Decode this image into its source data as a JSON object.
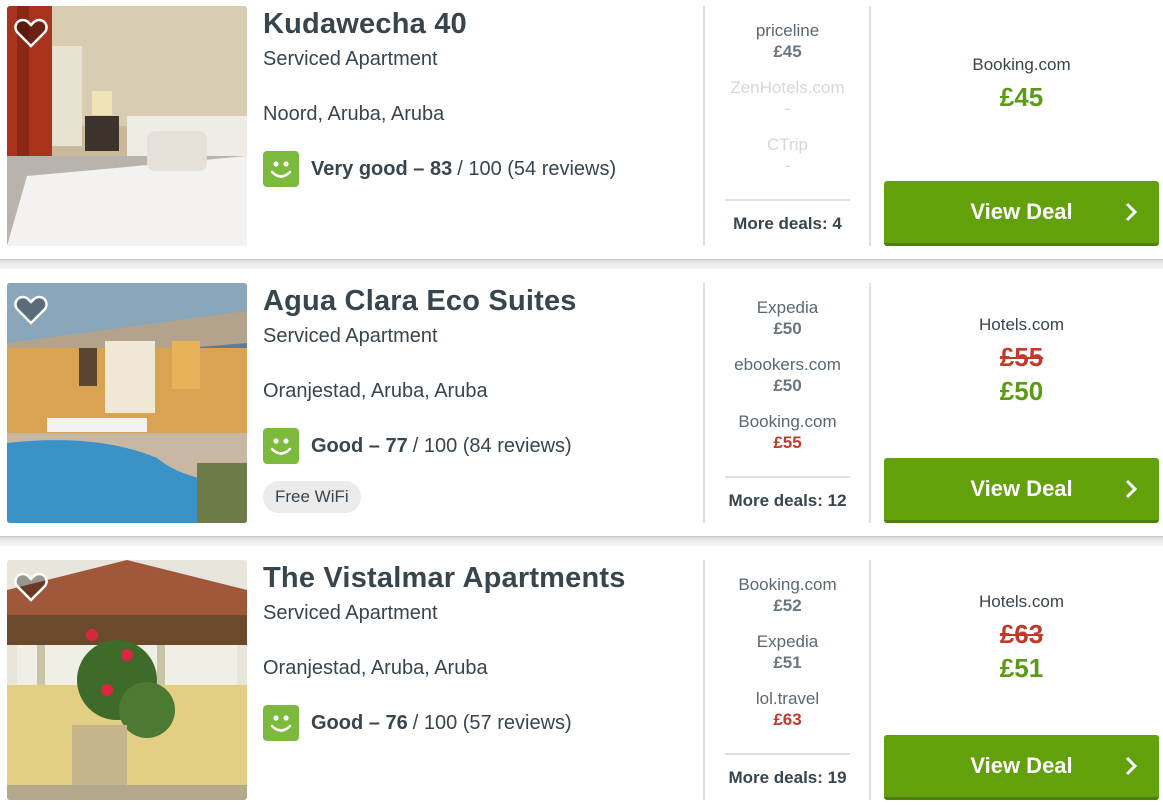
{
  "colors": {
    "accent_green": "#62a10b",
    "price_green": "#5a9a14",
    "strike_red": "#c0392b",
    "rating_green": "#7cba3d"
  },
  "icons": {
    "favorite": "heart-icon",
    "rating": "smiley-icon",
    "chevron": "chevron-right-icon"
  },
  "hotels": [
    {
      "name": "Kudawecha 40",
      "type": "Serviced Apartment",
      "location": "Noord, Aruba, Aruba",
      "rating_word": "Very good",
      "rating_score": "83",
      "rating_rest": "/ 100 (54 reviews)",
      "providers": [
        {
          "name": "priceline",
          "price": "£45"
        },
        {
          "name": "ZenHotels.com",
          "price": "-"
        },
        {
          "name": "CTrip",
          "price": "-"
        }
      ],
      "more_deals": "More deals: 4",
      "best_site": "Booking.com",
      "old_price": "",
      "best_price": "£45",
      "button": "View Deal"
    },
    {
      "name": "Agua Clara Eco Suites",
      "type": "Serviced Apartment",
      "location": "Oranjestad, Aruba, Aruba",
      "rating_word": "Good",
      "rating_score": "77",
      "rating_rest": "/ 100 (84 reviews)",
      "amenity": "Free WiFi",
      "providers": [
        {
          "name": "Expedia",
          "price": "£50"
        },
        {
          "name": "ebookers.com",
          "price": "£50"
        },
        {
          "name": "Booking.com",
          "price": "£55"
        }
      ],
      "more_deals": "More deals: 12",
      "best_site": "Hotels.com",
      "old_price": "£55",
      "best_price": "£50",
      "button": "View Deal"
    },
    {
      "name": "The Vistalmar Apartments",
      "type": "Serviced Apartment",
      "location": "Oranjestad, Aruba, Aruba",
      "rating_word": "Good",
      "rating_score": "76",
      "rating_rest": "/ 100 (57 reviews)",
      "providers": [
        {
          "name": "Booking.com",
          "price": "£52"
        },
        {
          "name": "Expedia",
          "price": "£51"
        },
        {
          "name": "lol.travel",
          "price": "£63"
        }
      ],
      "more_deals": "More deals: 19",
      "best_site": "Hotels.com",
      "old_price": "£63",
      "best_price": "£51",
      "button": "View Deal"
    }
  ]
}
